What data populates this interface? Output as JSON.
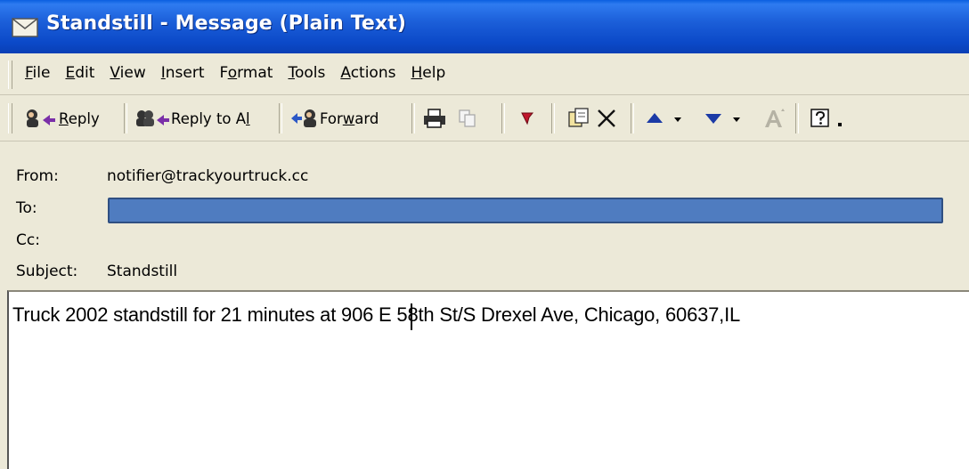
{
  "window": {
    "title": "Standstill - Message (Plain Text)",
    "title_icon": "envelope-icon"
  },
  "menu": {
    "items": [
      {
        "label_pre": "",
        "label_key": "F",
        "label_post": "ile"
      },
      {
        "label_pre": "",
        "label_key": "E",
        "label_post": "dit"
      },
      {
        "label_pre": "",
        "label_key": "V",
        "label_post": "iew"
      },
      {
        "label_pre": "",
        "label_key": "I",
        "label_post": "nsert"
      },
      {
        "label_pre": "F",
        "label_key": "o",
        "label_post": "rmat"
      },
      {
        "label_pre": "",
        "label_key": "T",
        "label_post": "ools"
      },
      {
        "label_pre": "",
        "label_key": "A",
        "label_post": "ctions"
      },
      {
        "label_pre": "",
        "label_key": "H",
        "label_post": "elp"
      }
    ]
  },
  "toolbar": {
    "reply_label_key": "R",
    "reply_label_post": "eply",
    "reply_all_label_pre": "Reply to A",
    "reply_all_label_key": "l",
    "reply_all_label_post": "l",
    "forward_label_pre": "For",
    "forward_label_key": "w",
    "forward_label_post": "ard"
  },
  "headers": {
    "from_label": "From:",
    "from_value": "notifier@trackyourtruck.cc",
    "to_label": "To:",
    "cc_label": "Cc:",
    "subject_label": "Subject:",
    "subject_value": "Standstill"
  },
  "message": {
    "body": "Truck 2002 standstill for 21 minutes at 906 E 58th St/S Drexel Ave, Chicago, 60637,IL"
  },
  "colors": {
    "titlebar": "#0a4fd0",
    "chrome": "#ece9d8",
    "redaction": "#4f7cc0"
  }
}
